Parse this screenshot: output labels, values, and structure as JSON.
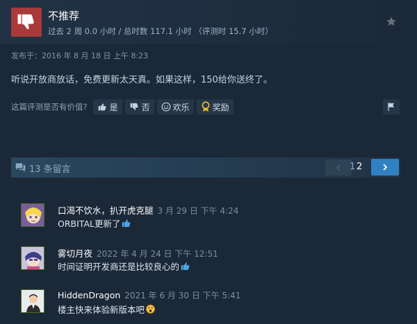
{
  "review": {
    "verdict": "不推荐",
    "hours_line": "过去 2 周 0.0 小时 / 总时数 117.1 小时 （评测时 15.7 小时）",
    "posted": "发布于：2016 年 8 月 18 日 上午 8:23",
    "body": "听说开放商放话，免费更新太天真。如果这样，150给你送终了。"
  },
  "helpful": {
    "question": "这篇评测是否有价值?",
    "yes_label": "是",
    "no_label": "否",
    "funny_label": "欢乐",
    "award_label": "奖励"
  },
  "comments_bar": {
    "count_label": "13 条留言",
    "pages": [
      "1",
      "2"
    ],
    "current_page": "2"
  },
  "comments": [
    {
      "author": "口渴不饮水，扒开虎克腿",
      "date": "3 月 29 日 下午 4:24",
      "text": "ORBITAL更新了",
      "emoji": "thumbs-up-icon"
    },
    {
      "author": "雾切月夜",
      "date": "2022 年 4 月 24 日 下午 12:51",
      "text": "时间证明开发商还是比较良心的",
      "emoji": "thumbs-up-icon"
    },
    {
      "author": "HiddenDragon",
      "date": "2021 年 6 月 30 日 下午 5:41",
      "text": "楼主快来体验新版本吧",
      "emoji": "surprised-face-icon"
    }
  ],
  "colors": {
    "background": "#1b2838",
    "thumb_down_box": "#a83a3a",
    "next_button": "#2f81c2",
    "comments_bar": "#2a475e"
  }
}
